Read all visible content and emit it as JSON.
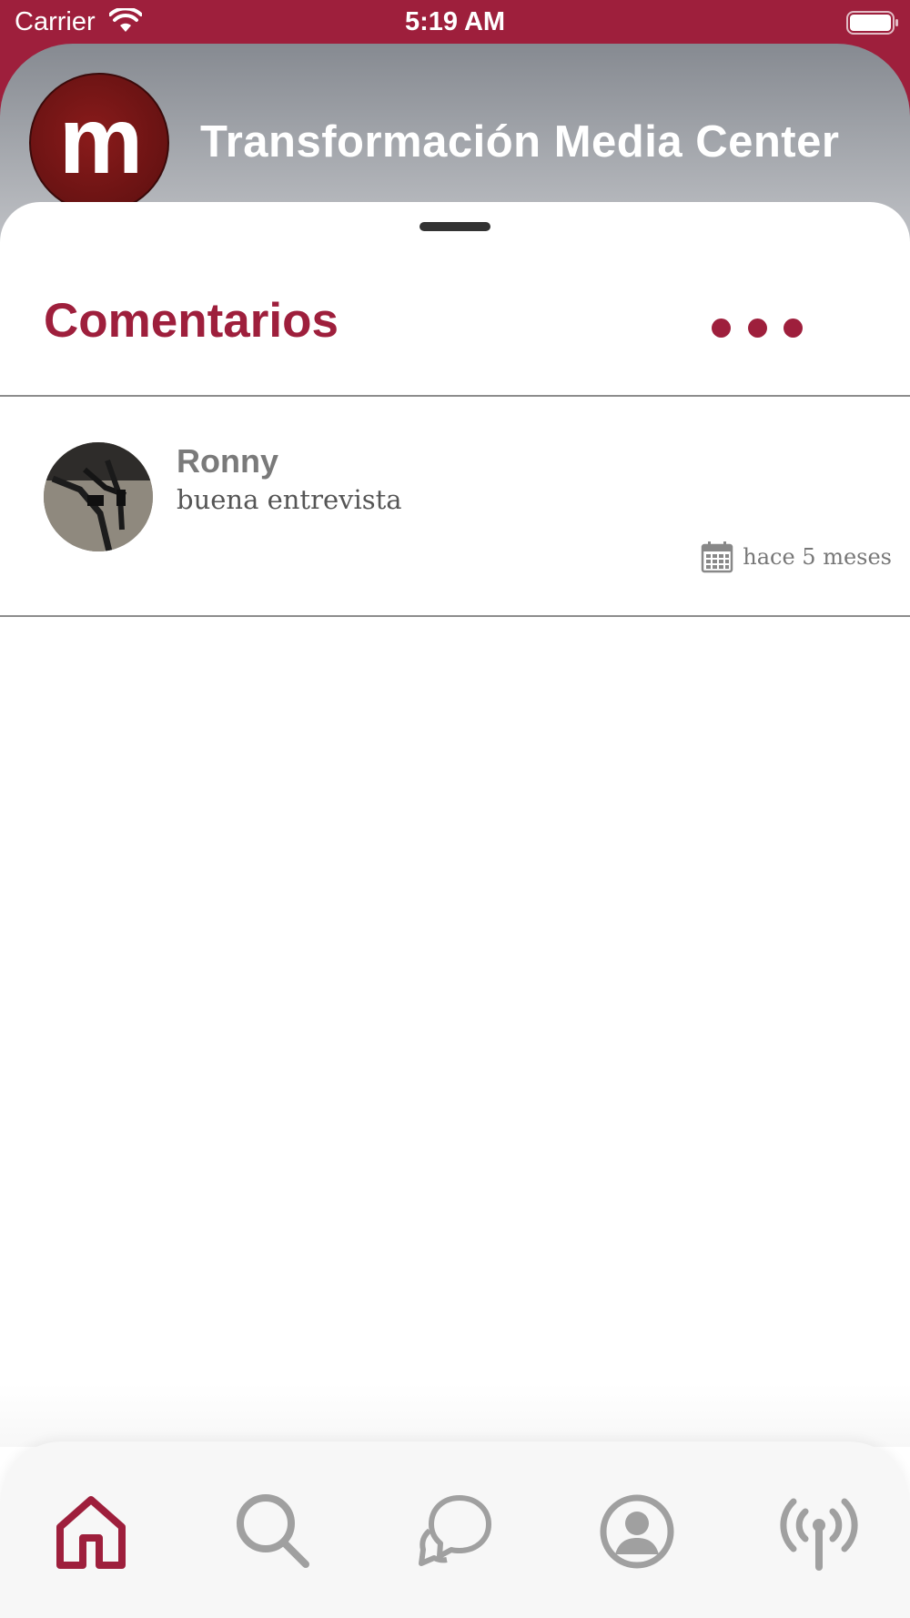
{
  "status_bar": {
    "carrier": "Carrier",
    "time": "5:19 AM"
  },
  "header": {
    "logo_letter": "m",
    "title": "Transformación Media Center"
  },
  "sheet": {
    "title": "Comentarios",
    "more_icon": "more-horizontal-icon"
  },
  "comments": [
    {
      "author": "Ronny",
      "text": "buena entrevista",
      "time": "hace 5 meses",
      "time_icon": "calendar-icon"
    }
  ],
  "tab_bar": {
    "tabs": [
      {
        "icon": "home-icon",
        "active": true
      },
      {
        "icon": "search-icon",
        "active": false
      },
      {
        "icon": "chat-icon",
        "active": false
      },
      {
        "icon": "profile-icon",
        "active": false
      },
      {
        "icon": "broadcast-icon",
        "active": false
      }
    ]
  },
  "colors": {
    "brand": "#9e1f3c",
    "inactive_icon": "#a0a0a0",
    "header_gradient_top": "#868a91",
    "header_gradient_bottom": "#c5c7cb"
  }
}
